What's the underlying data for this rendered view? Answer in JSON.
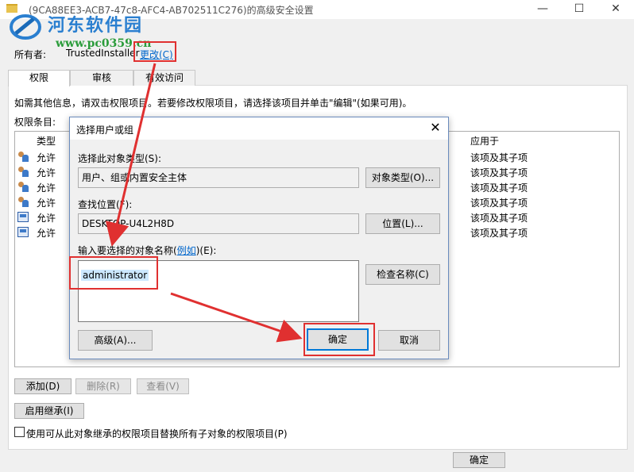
{
  "window": {
    "title": "(9CA88EE3-ACB7-47c8-AFC4-AB702511C276)的高级安全设置",
    "minimize": "—",
    "maximize": "☐",
    "close": "✕"
  },
  "watermark": {
    "text": "河东软件园",
    "url": "www.pc0359.cn"
  },
  "owner": {
    "label": "所有者:",
    "value": "TrustedInstaller",
    "change_link": "更改(C)"
  },
  "tabs": [
    {
      "label": "权限"
    },
    {
      "label": "审核"
    },
    {
      "label": "有效访问"
    }
  ],
  "info_text": "如需其他信息，请双击权限项目。若要修改权限项目，请选择该项目并单击\"编辑\"(如果可用)。",
  "entries_label": "权限条目:",
  "perm_columns": {
    "type": "类型",
    "apply_to": "应用于"
  },
  "perm_rows": [
    {
      "type": "允许",
      "apply_to": "该项及其子项",
      "icon": "user-group-icon"
    },
    {
      "type": "允许",
      "apply_to": "该项及其子项",
      "icon": "user-group-icon"
    },
    {
      "type": "允许",
      "apply_to": "该项及其子项",
      "icon": "user-group-icon"
    },
    {
      "type": "允许",
      "apply_to": "该项及其子项",
      "icon": "user-group-icon"
    },
    {
      "type": "允许",
      "apply_to": "该项及其子项",
      "icon": "system-icon"
    },
    {
      "type": "允许",
      "apply_to": "该项及其子项",
      "icon": "system-icon"
    }
  ],
  "buttons": {
    "add": "添加(D)",
    "remove": "删除(R)",
    "view": "查看(V)",
    "enable_inheritance": "启用继承(I)",
    "ok": "确定"
  },
  "replace_checkbox": {
    "label": "使用可从此对象继承的权限项目替换所有子对象的权限项目(P)",
    "checked": false
  },
  "dialog": {
    "title": "选择用户或组",
    "close": "✕",
    "object_type_label": "选择此对象类型(S):",
    "object_type_value": "用户、组或内置安全主体",
    "object_type_button": "对象类型(O)...",
    "location_label": "查找位置(F):",
    "location_value": "DESKTOP-U4L2H8D",
    "location_button": "位置(L)...",
    "name_label_prefix": "输入要选择的对象名称(",
    "name_label_link": "例如",
    "name_label_suffix": ")(E):",
    "name_value": "administrator",
    "check_names_button": "检查名称(C)",
    "advanced_button": "高级(A)...",
    "ok_button": "确定",
    "cancel_button": "取消"
  },
  "colors": {
    "annotation": "#e03030",
    "link": "#0066cc",
    "focus": "#0078d7",
    "selection": "#cce8ff"
  }
}
